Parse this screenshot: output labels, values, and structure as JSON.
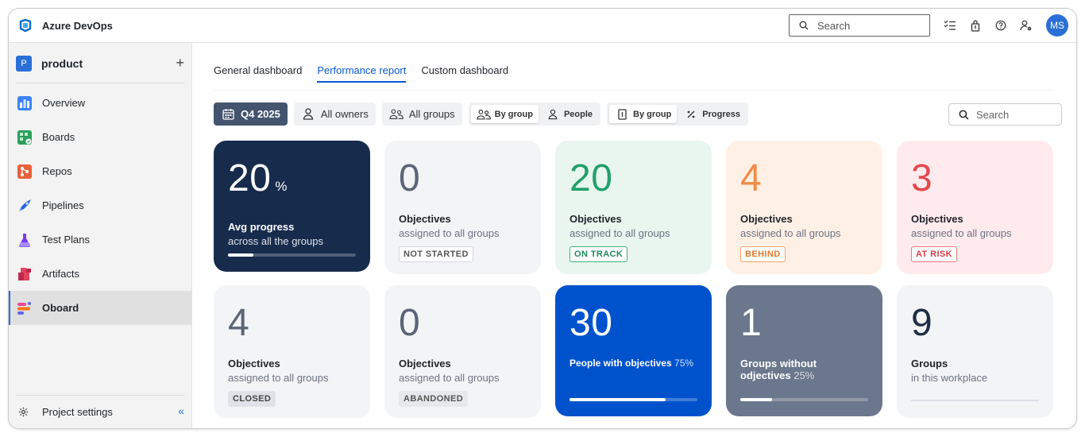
{
  "app": {
    "title": "Azure DevOps",
    "search_placeholder": "Search",
    "avatar_initials": "MS"
  },
  "sidebar": {
    "project_badge": "P",
    "project_name": "product",
    "add_label": "+",
    "items": [
      {
        "label": "Overview",
        "icon": "overview-icon"
      },
      {
        "label": "Boards",
        "icon": "boards-icon"
      },
      {
        "label": "Repos",
        "icon": "repos-icon"
      },
      {
        "label": "Pipelines",
        "icon": "pipelines-icon"
      },
      {
        "label": "Test Plans",
        "icon": "test-plans-icon"
      },
      {
        "label": "Artifacts",
        "icon": "artifacts-icon"
      },
      {
        "label": "Oboard",
        "icon": "oboard-icon",
        "active": true
      }
    ],
    "settings_label": "Project settings",
    "collapse_label": "«"
  },
  "tabs": [
    {
      "label": "General dashboard"
    },
    {
      "label": "Performance report",
      "active": true
    },
    {
      "label": "Custom dashboard"
    }
  ],
  "filters": {
    "period": "Q4 2025",
    "owners": "All owners",
    "groups": "All groups",
    "view_group": "By group",
    "view_people": "People",
    "mode_group": "By group",
    "mode_progress": "Progress",
    "search_placeholder": "Search"
  },
  "cards": {
    "avg": {
      "value": "20",
      "unit": "%",
      "title": "Avg progress",
      "sub": "across all the groups",
      "progress": 0.2
    },
    "not_started": {
      "value": "0",
      "title": "Objectives",
      "sub": "assigned to all groups",
      "badge": "NOT STARTED"
    },
    "on_track": {
      "value": "20",
      "title": "Objectives",
      "sub": "assigned to all groups",
      "badge": "ON TRACK"
    },
    "behind": {
      "value": "4",
      "title": "Objectives",
      "sub": "assigned to all groups",
      "badge": "BEHIND"
    },
    "at_risk": {
      "value": "3",
      "title": "Objectives",
      "sub": "assigned to all groups",
      "badge": "AT RISK"
    },
    "closed": {
      "value": "4",
      "title": "Objectives",
      "sub": "assigned to all groups",
      "badge": "CLOSED"
    },
    "abandoned": {
      "value": "0",
      "title": "Objectives",
      "sub": "assigned to all groups",
      "badge": "ABANDONED"
    },
    "people": {
      "value": "30",
      "title": "People with objectives",
      "pct": "75%",
      "progress": 0.75
    },
    "groups_without": {
      "value": "1",
      "title_line1": "Groups without",
      "title_line2": "odjectives",
      "pct": "25%",
      "progress": 0.25
    },
    "groups": {
      "value": "9",
      "title": "Groups",
      "sub": "in this workplace",
      "progress": 0
    }
  },
  "colors": {
    "accent": "#0b57d0",
    "dark_card": "#172b4d",
    "green": "#22a06b",
    "orange": "#f18d46",
    "red": "#e5484d",
    "blue_card": "#0052cc",
    "slate_card": "#6b778c"
  }
}
